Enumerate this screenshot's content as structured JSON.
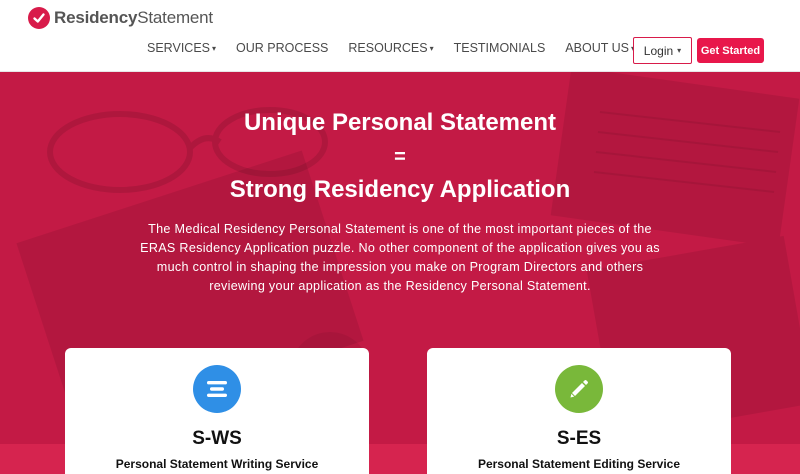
{
  "brand": {
    "name_bold": "Residency",
    "name_light": "Statement",
    "accent": "#d81b4a"
  },
  "nav": {
    "items": [
      {
        "label": "SERVICES",
        "dropdown": true
      },
      {
        "label": "OUR PROCESS",
        "dropdown": false
      },
      {
        "label": "RESOURCES",
        "dropdown": true
      },
      {
        "label": "TESTIMONIALS",
        "dropdown": false
      },
      {
        "label": "ABOUT US",
        "dropdown": true
      }
    ],
    "caret": "▾",
    "login_label": "Login",
    "get_started_label": "Get Started"
  },
  "hero": {
    "title_line1": "Unique Personal Statement",
    "equals": "=",
    "title_line2": "Strong Residency Application",
    "paragraph": "The Medical Residency Personal Statement is one of the most important pieces of the ERAS Residency Application puzzle. No other component of the application gives you as much control in shaping the impression you make on Program Directors and others reviewing your application as the Residency Personal Statement.",
    "background_color": "#c31a45"
  },
  "cards": [
    {
      "code": "S-WS",
      "title": "Personal Statement Writing Service",
      "icon": "text-lines-icon",
      "icon_color": "#2f8fe6"
    },
    {
      "code": "S-ES",
      "title": "Personal Statement Editing Service",
      "icon": "pencil-icon",
      "icon_color": "#79b83a"
    }
  ]
}
